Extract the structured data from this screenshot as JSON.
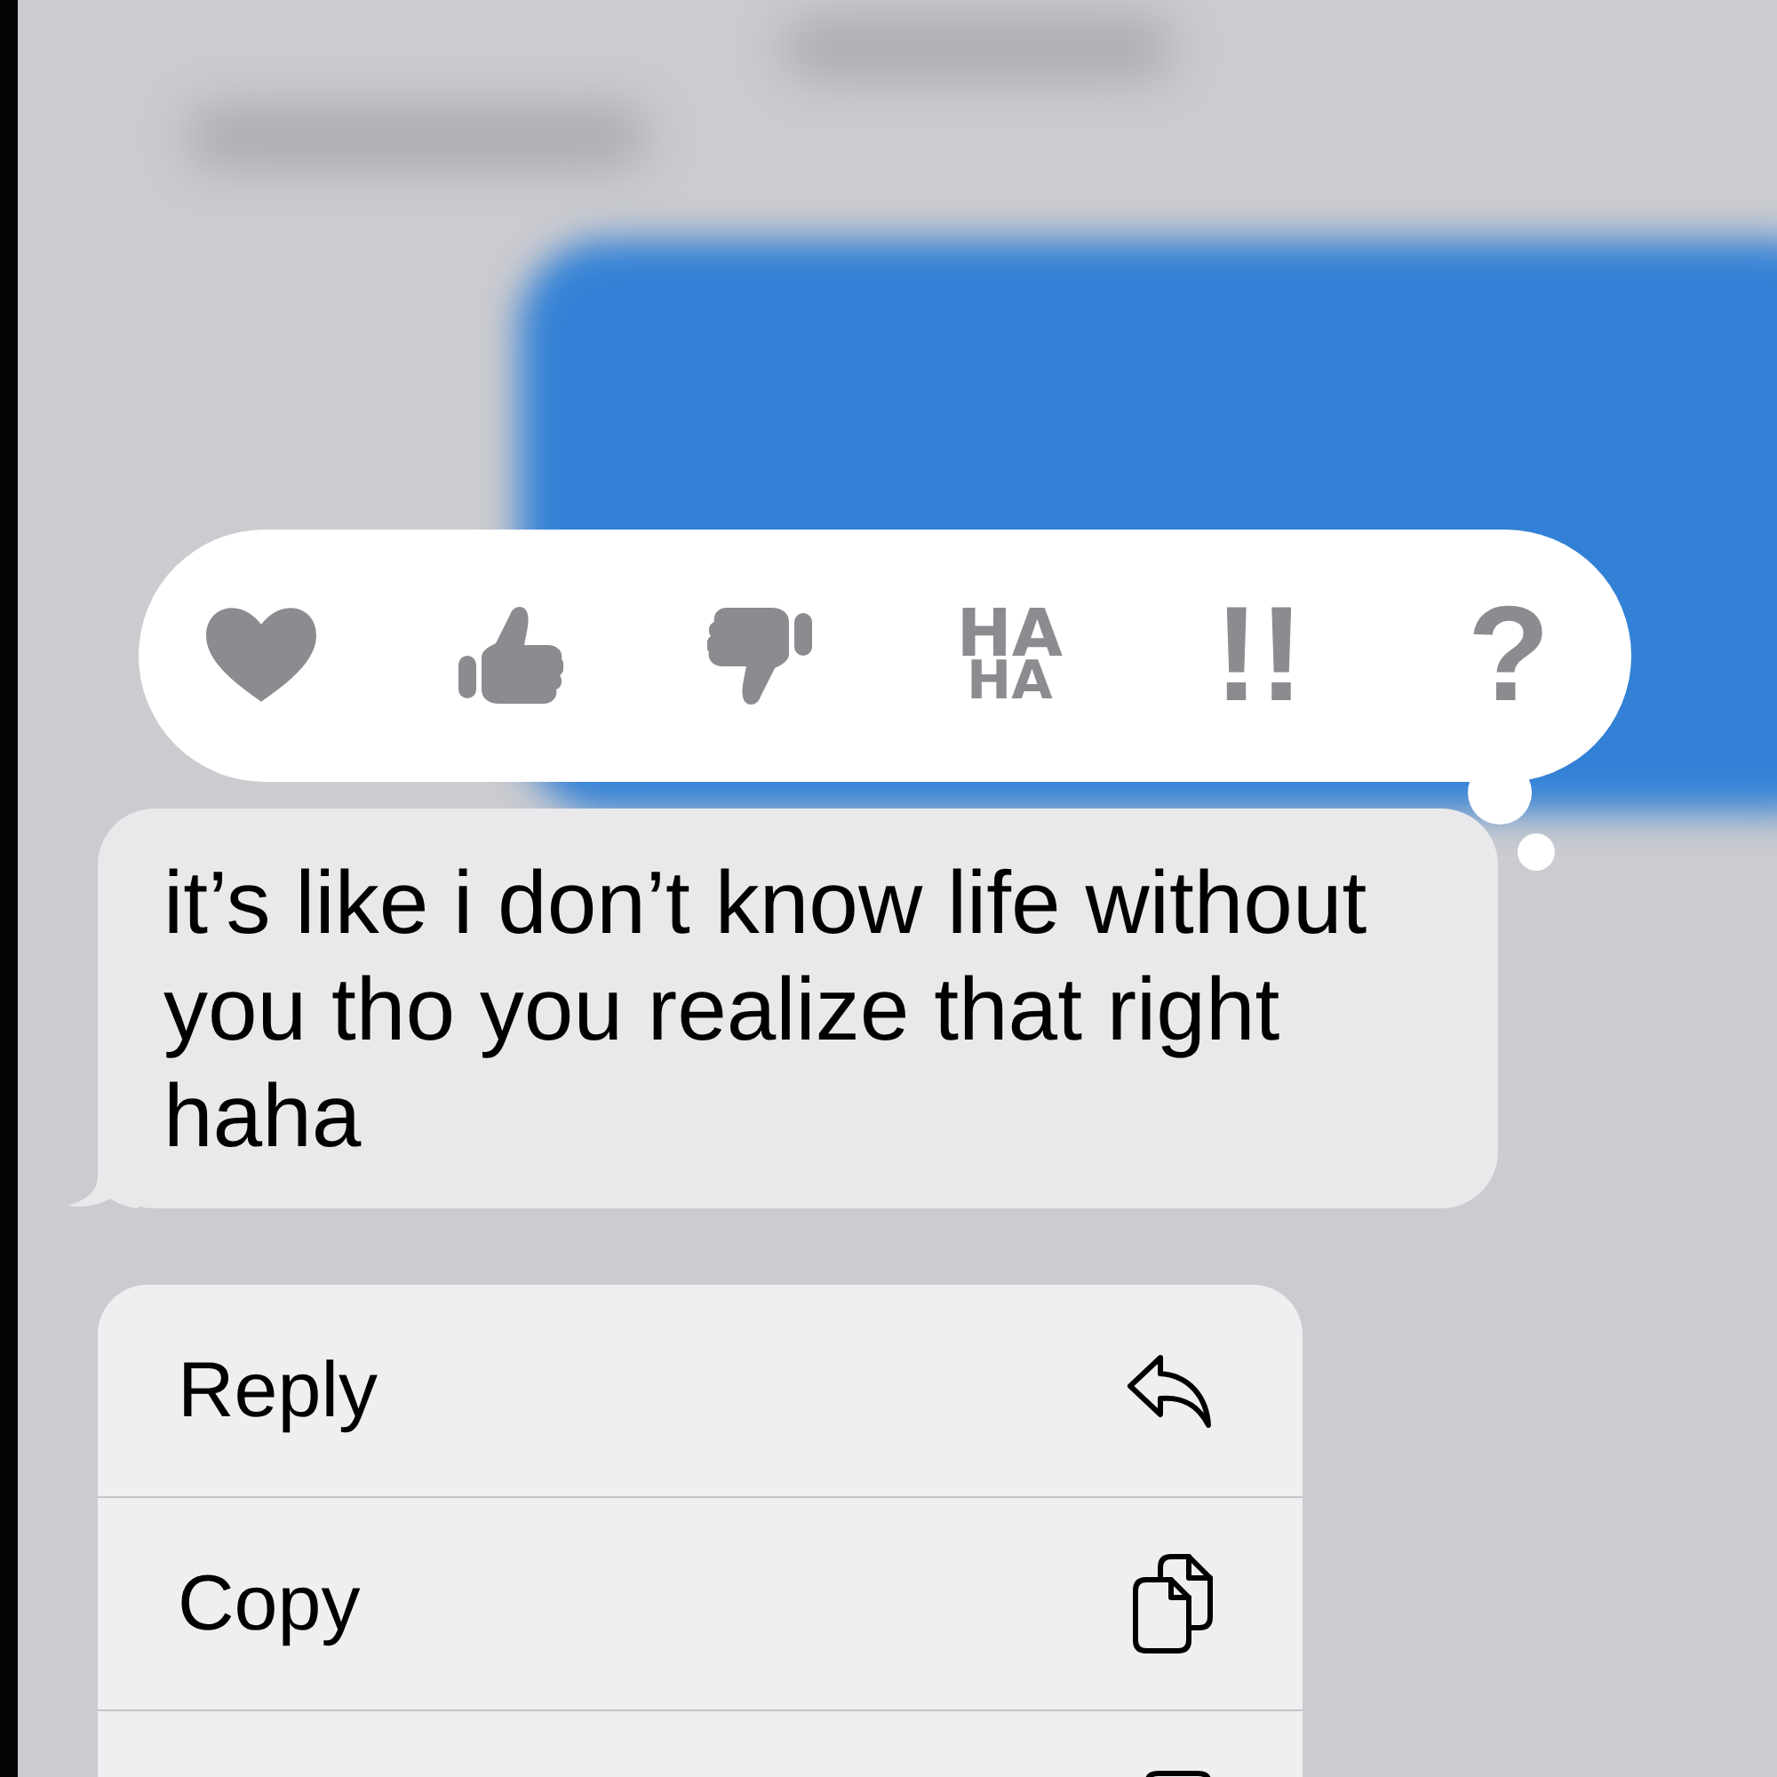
{
  "background": {
    "blurred_items": [
      {
        "kind": "dark_edge"
      },
      {
        "kind": "text"
      },
      {
        "kind": "text"
      },
      {
        "kind": "sent_bubble"
      }
    ]
  },
  "tapbacks": [
    {
      "kind": "heart",
      "selected": false
    },
    {
      "kind": "thumbs_up",
      "selected": false
    },
    {
      "kind": "thumbs_down",
      "selected": false
    },
    {
      "kind": "text",
      "lines": [
        "HA",
        "HA"
      ],
      "selected": false
    },
    {
      "kind": "text",
      "lines": [
        "!!"
      ],
      "selected": false
    },
    {
      "kind": "text",
      "lines": [
        "?"
      ],
      "selected": false
    }
  ],
  "message": {
    "text": "it’s like i don’t know life without you tho you realize that right haha"
  },
  "menu": {
    "items": [
      {
        "kind": "reply",
        "label": "Reply"
      },
      {
        "kind": "copy",
        "label": "Copy"
      },
      {
        "kind": "cut_off"
      }
    ]
  }
}
